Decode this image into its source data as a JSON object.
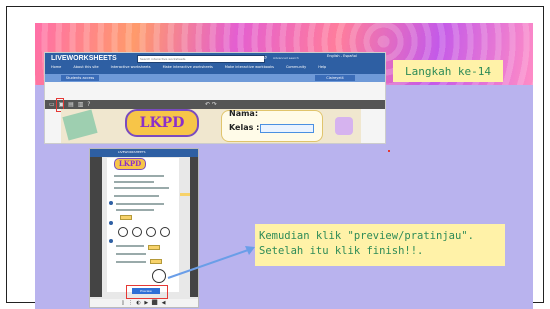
{
  "slide": {
    "step_label": "Langkah ke-14",
    "instruction_line1": "Kemudian klik \"preview/pratinjau\".",
    "instruction_line2": "Setelah itu klik finish!!."
  },
  "liveworksheets": {
    "logo": "LIVEWORKSHEETS",
    "search_placeholder": "Search interactive worksheets",
    "advanced_search": "Advanced search",
    "languages": "English - Español",
    "menu": [
      "Home",
      "About this site",
      "Interactive worksheets",
      "Make interactive worksheets",
      "Make interactive workbooks",
      "Community",
      "Help"
    ],
    "students_access": "Students access",
    "user_menu": "Claireyel4",
    "toolbar_icons": "▭ ▣ ▤ ▥ ?",
    "undo_redo": "↶ ↷",
    "worksheet_title": "LKPD",
    "nama_label": "Nama:",
    "kelas_label": "Kelas :"
  },
  "preview_shot": {
    "header_text": "LIVEWORKSHEETS",
    "lkpd_title": "LKPD",
    "preview_button": "Preview",
    "taskbar_icons": "▯ ⋮ ◐ ▶ ⬛ ◀"
  },
  "colors": {
    "slide_bg": "#b9b3ee",
    "callout_bg": "#fff2a8",
    "callout_text": "#2e8b57",
    "nav_blue": "#2e5fa3",
    "highlight_red": "#e53935",
    "arrow_blue": "#6a9ee8"
  }
}
